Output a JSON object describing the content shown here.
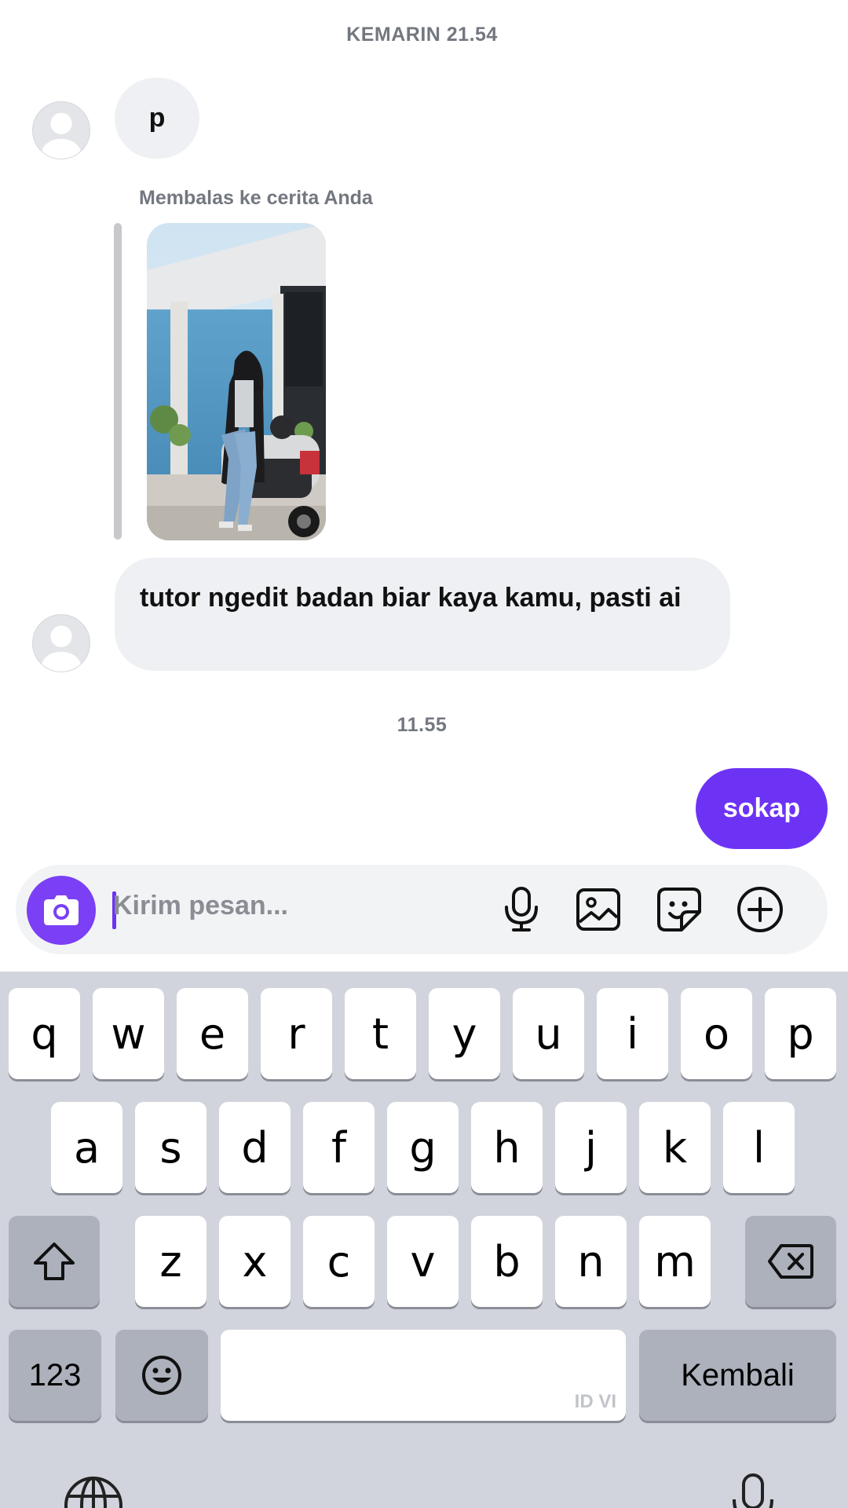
{
  "chat": {
    "timestamp_1": "KEMARIN 21.54",
    "msg_p": "p",
    "reply_label": "Membalas ke cerita Anda",
    "msg_long": "tutor ngedit badan biar  kaya kamu, pasti ai",
    "timestamp_2": "11.55",
    "msg_sent": "sokap"
  },
  "composer": {
    "placeholder": "Kirim pesan...",
    "icons": [
      "camera-icon",
      "microphone-icon",
      "gallery-icon",
      "sticker-icon",
      "plus-circle-icon"
    ]
  },
  "keyboard": {
    "row1": [
      "q",
      "w",
      "e",
      "r",
      "t",
      "y",
      "u",
      "i",
      "o",
      "p"
    ],
    "row2": [
      "a",
      "s",
      "d",
      "f",
      "g",
      "h",
      "j",
      "k",
      "l"
    ],
    "row3": [
      "z",
      "x",
      "c",
      "v",
      "b",
      "n",
      "m"
    ],
    "numbers_label": "123",
    "return_label": "Kembali",
    "space_hint": "ID VI",
    "icons": [
      "shift-icon",
      "backspace-icon",
      "emoji-icon",
      "globe-icon",
      "dictation-mic-icon"
    ]
  },
  "colors": {
    "accent": "#6d33f5",
    "bubble_incoming": "#eef0f3",
    "keyboard_bg": "#d1d4dc"
  }
}
